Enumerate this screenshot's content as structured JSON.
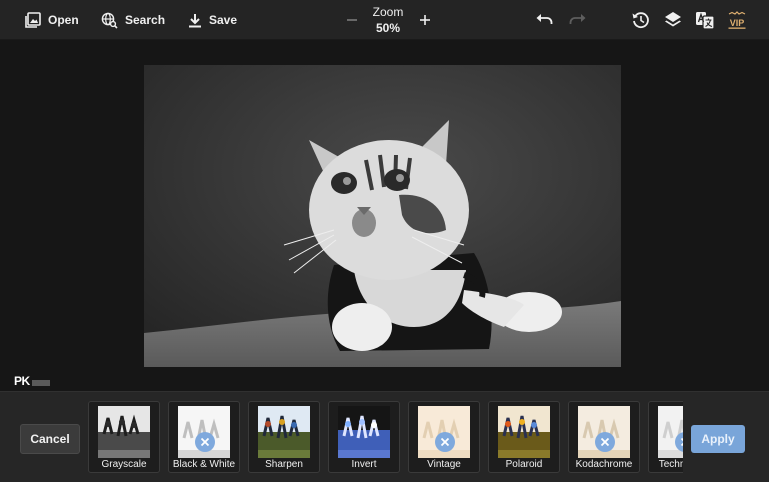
{
  "toolbar": {
    "open_label": "Open",
    "search_label": "Search",
    "save_label": "Save",
    "zoom_label": "Zoom",
    "zoom_value": "50%",
    "vip_label": "VIP"
  },
  "watermark": {
    "text": "PK"
  },
  "actions": {
    "cancel_label": "Cancel",
    "apply_label": "Apply"
  },
  "filters": [
    {
      "name": "Grayscale",
      "unavailable": false
    },
    {
      "name": "Black & White",
      "unavailable": true
    },
    {
      "name": "Sharpen",
      "unavailable": false
    },
    {
      "name": "Invert",
      "unavailable": false
    },
    {
      "name": "Vintage",
      "unavailable": true
    },
    {
      "name": "Polaroid",
      "unavailable": false
    },
    {
      "name": "Kodachrome",
      "unavailable": true
    },
    {
      "name": "Technicolor",
      "unavailable": true
    }
  ],
  "colors": {
    "apply_button": "#79a5d9",
    "vip_badge": "#e0b070",
    "toolbar_bg": "#242424"
  }
}
